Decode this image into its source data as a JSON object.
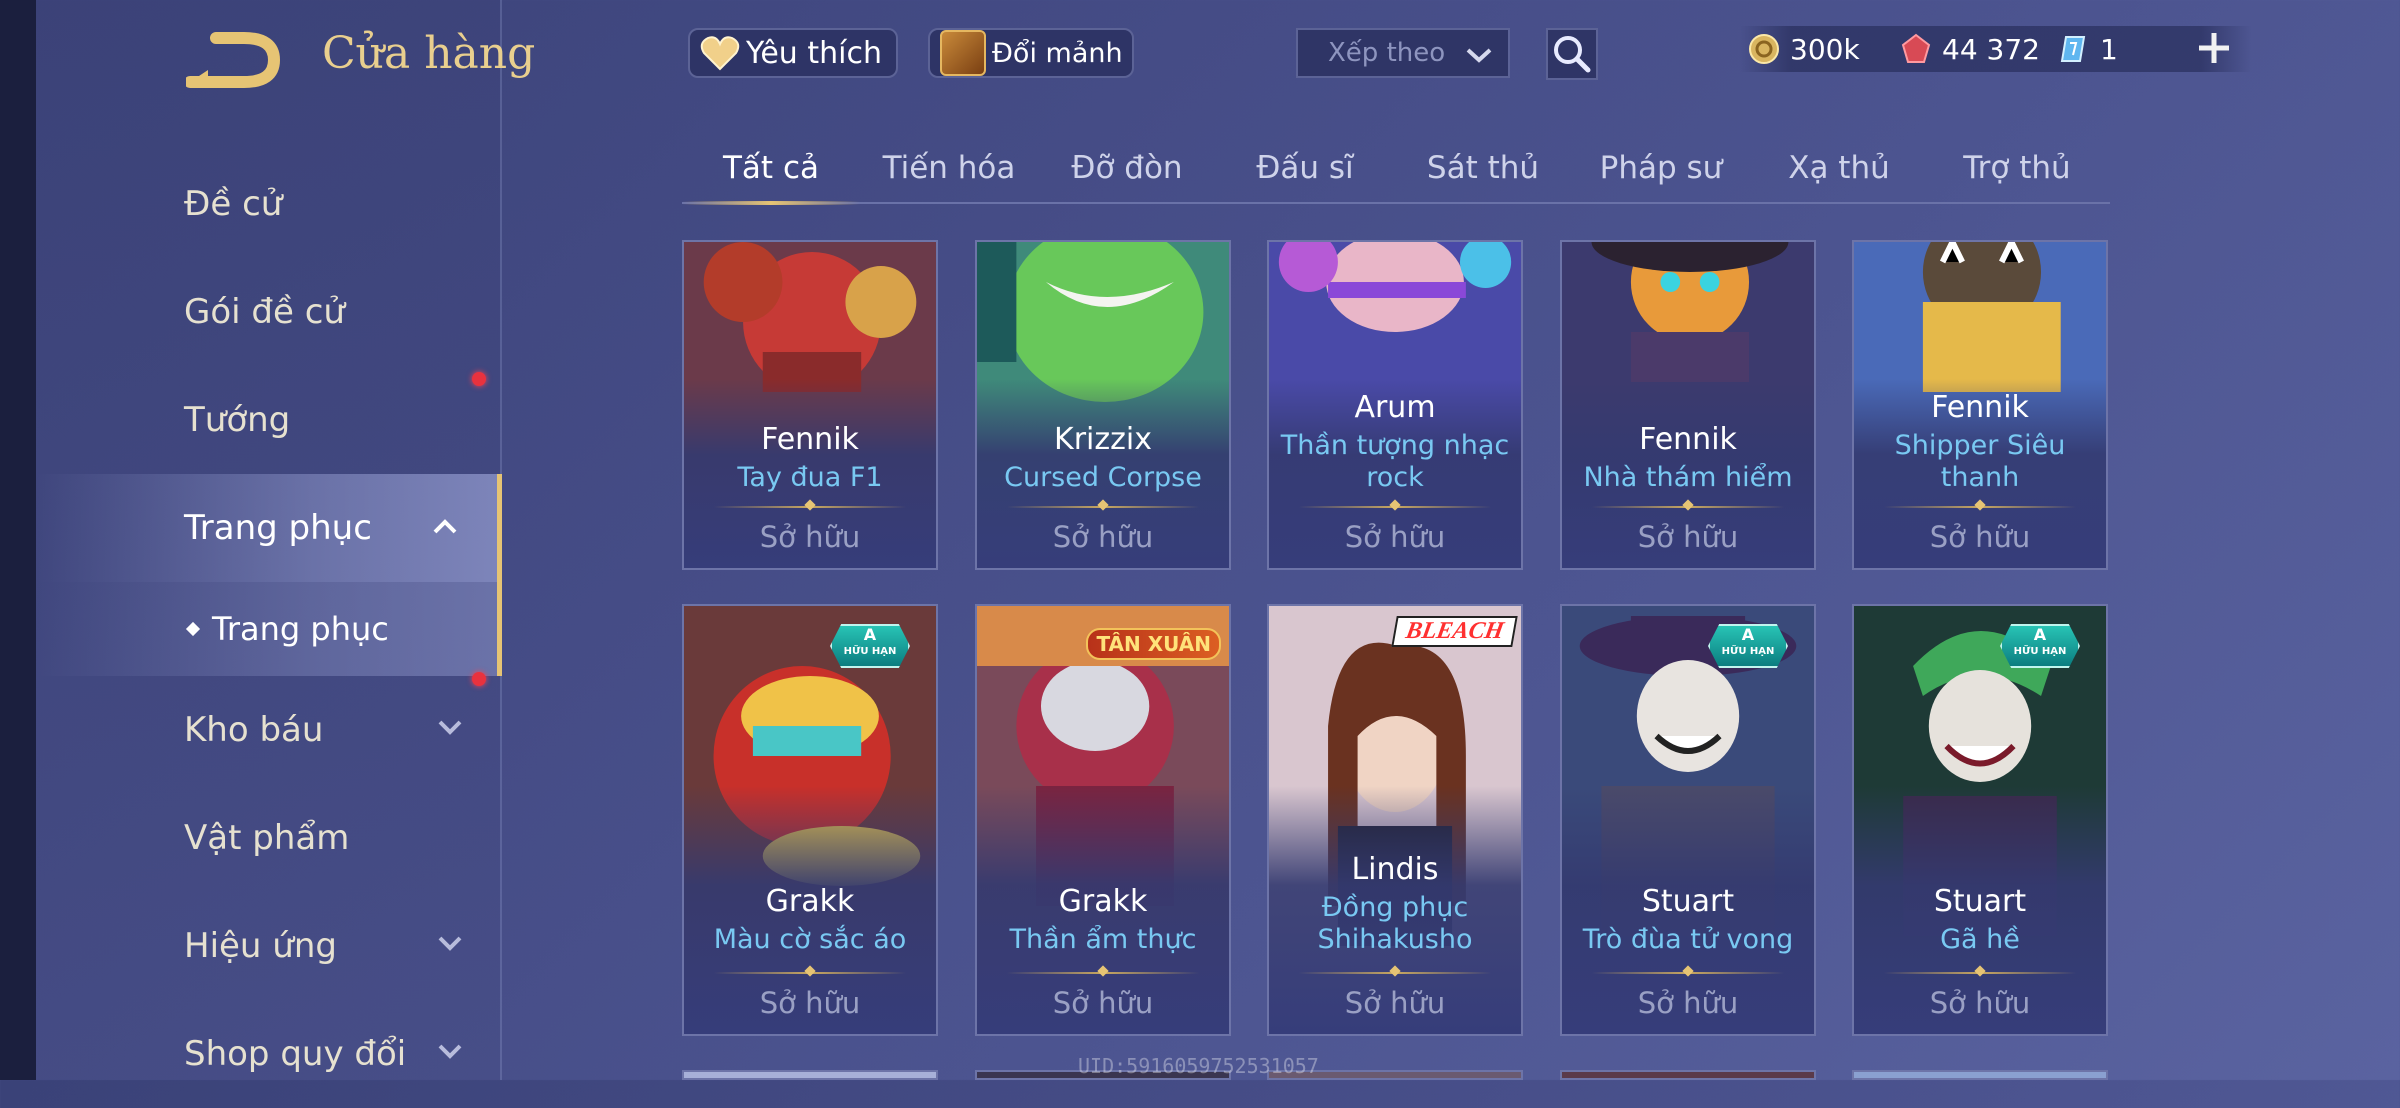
{
  "header": {
    "title": "Cửa hàng",
    "favorites_label": "Yêu thích",
    "exchange_label": "Đổi mảnh",
    "sort_placeholder": "Xếp theo",
    "currencies": [
      {
        "name": "gold-coin-icon",
        "value": "300k"
      },
      {
        "name": "ruby-icon",
        "value": "44 372"
      },
      {
        "name": "ticket-icon",
        "value": "1"
      }
    ]
  },
  "sidebar": {
    "items": [
      {
        "label": "Đề cử"
      },
      {
        "label": "Gói đề cử",
        "dot": true
      },
      {
        "label": "Tướng"
      },
      {
        "label": "Trang phục",
        "expanded": true
      },
      {
        "label": "Trang phục",
        "sub": true
      },
      {
        "label": "Kho báu",
        "dot": true
      },
      {
        "label": "Vật phẩm"
      },
      {
        "label": "Hiệu ứng"
      },
      {
        "label": "Shop quy đổi"
      }
    ]
  },
  "tabs": [
    "Tất cả",
    "Tiến hóa",
    "Đỡ đòn",
    "Đấu sĩ",
    "Sát thủ",
    "Pháp sư",
    "Xạ thủ",
    "Trợ thủ"
  ],
  "active_tab": "Tất cả",
  "cards": [
    {
      "hero": "Fennik",
      "skin": "Tay đua F1",
      "status": "Sở hữu"
    },
    {
      "hero": "Krizzix",
      "skin": "Cursed Corpse",
      "status": "Sở hữu"
    },
    {
      "hero": "Arum",
      "skin": "Thần tượng nhạc rock",
      "status": "Sở hữu"
    },
    {
      "hero": "Fennik",
      "skin": "Nhà thám hiểm",
      "status": "Sở hữu"
    },
    {
      "hero": "Fennik",
      "skin": "Shipper Siêu thanh",
      "status": "Sở hữu"
    },
    {
      "hero": "Grakk",
      "skin": "Màu cờ sắc áo",
      "status": "Sở hữu",
      "badge_top": "A",
      "badge_bottom": "HỮU HẠN"
    },
    {
      "hero": "Grakk",
      "skin": "Thần ẩm thực",
      "status": "Sở hữu",
      "event_badge": "TÂN XUÂN"
    },
    {
      "hero": "Lindis",
      "skin": "Đồng phục Shihakusho",
      "status": "Sở hữu",
      "collab_badge": "BLEACH"
    },
    {
      "hero": "Stuart",
      "skin": "Trò đùa tử vong",
      "status": "Sở hữu",
      "badge_top": "A",
      "badge_bottom": "HỮU HẠN"
    },
    {
      "hero": "Stuart",
      "skin": "Gã hề",
      "status": "Sở hữu",
      "badge_top": "A",
      "badge_bottom": "HỮU HẠN"
    }
  ],
  "footer": {
    "uid": "UID:5916059752531057"
  },
  "colors": {
    "accent_gold": "#e6c474",
    "skin_name_blue": "#79c9f2",
    "red_dot": "#e8323e"
  }
}
